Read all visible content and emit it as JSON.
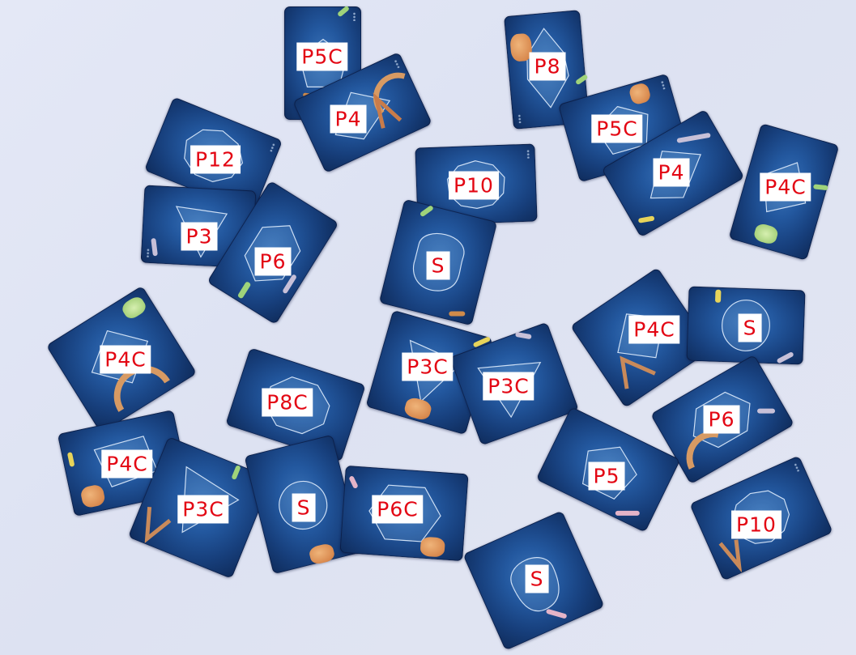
{
  "scene": {
    "description_kind": "photo of shape cards with overlaid labels",
    "label_color": "#e30613",
    "label_background": "#ffffff",
    "card_color": "#1d4a8a",
    "table_color": "#e1e5f3"
  },
  "cards": [
    {
      "id": "c01",
      "label": "P5C",
      "shape": "pentagon"
    },
    {
      "id": "c02",
      "label": "P4",
      "shape": "quadrilateral"
    },
    {
      "id": "c03",
      "label": "P8",
      "shape": "octagon"
    },
    {
      "id": "c04",
      "label": "P5C",
      "shape": "pentagon"
    },
    {
      "id": "c05",
      "label": "P4",
      "shape": "quadrilateral"
    },
    {
      "id": "c06",
      "label": "P4C",
      "shape": "quadrilateral"
    },
    {
      "id": "c07",
      "label": "P12",
      "shape": "dodecagon"
    },
    {
      "id": "c08",
      "label": "P10",
      "shape": "decagon"
    },
    {
      "id": "c09",
      "label": "P3",
      "shape": "triangle"
    },
    {
      "id": "c10",
      "label": "P6",
      "shape": "hexagon"
    },
    {
      "id": "c11",
      "label": "S",
      "shape": "curve"
    },
    {
      "id": "c12",
      "label": "P4C",
      "shape": "quadrilateral"
    },
    {
      "id": "c13",
      "label": "S",
      "shape": "curve"
    },
    {
      "id": "c14",
      "label": "P4C",
      "shape": "quadrilateral"
    },
    {
      "id": "c15",
      "label": "P3C",
      "shape": "triangle"
    },
    {
      "id": "c16",
      "label": "P3C",
      "shape": "triangle"
    },
    {
      "id": "c17",
      "label": "P8C",
      "shape": "octagon"
    },
    {
      "id": "c18",
      "label": "P6",
      "shape": "hexagon"
    },
    {
      "id": "c19",
      "label": "P4C",
      "shape": "quadrilateral"
    },
    {
      "id": "c20",
      "label": "P3C",
      "shape": "triangle"
    },
    {
      "id": "c21",
      "label": "S",
      "shape": "curve"
    },
    {
      "id": "c22",
      "label": "P6C",
      "shape": "hexagon"
    },
    {
      "id": "c23",
      "label": "P5",
      "shape": "pentagon"
    },
    {
      "id": "c24",
      "label": "P10",
      "shape": "decagon"
    },
    {
      "id": "c25",
      "label": "S",
      "shape": "curve"
    }
  ]
}
